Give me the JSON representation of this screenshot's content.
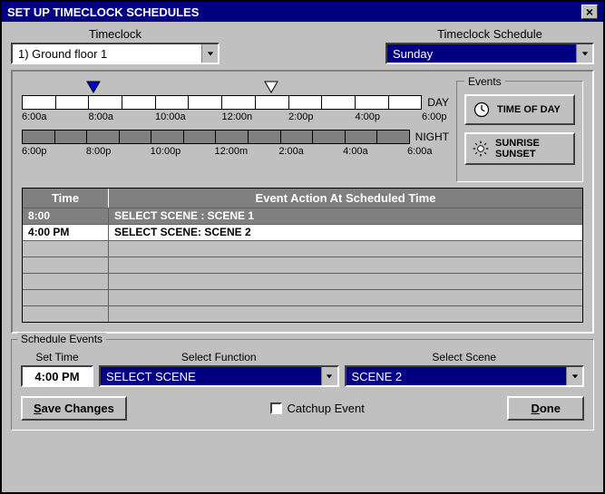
{
  "title": "SET UP TIMECLOCK SCHEDULES",
  "top": {
    "timeclock_label": "Timeclock",
    "timeclock_value": "1) Ground floor 1",
    "schedule_label": "Timeclock Schedule",
    "schedule_value": "Sunday"
  },
  "timeline": {
    "day_label": "DAY",
    "night_label": "NIGHT",
    "day_ticks": [
      "6:00a",
      "8:00a",
      "10:00a",
      "12:00n",
      "2:00p",
      "4:00p",
      "6:00p"
    ],
    "night_ticks": [
      "6:00p",
      "8:00p",
      "10:00p",
      "12:00m",
      "2:00a",
      "4:00a",
      "6:00a"
    ],
    "markers": [
      {
        "pos_pct": 16.7,
        "color": "blue"
      },
      {
        "pos_pct": 58.3,
        "color": "white"
      }
    ]
  },
  "events_box": {
    "legend": "Events",
    "time_of_day": "TIME OF DAY",
    "sunrise_sunset": "SUNRISE SUNSET"
  },
  "table": {
    "col_time": "Time",
    "col_action": "Event Action At Scheduled Time",
    "rows": [
      {
        "time": "8:00",
        "action": "SELECT SCENE : SCENE 1",
        "selected": false
      },
      {
        "time": "4:00 PM",
        "action": "SELECT SCENE: SCENE 2",
        "selected": true
      }
    ],
    "empty_rows": 5
  },
  "schedule_events": {
    "legend": "Schedule Events",
    "set_time_label": "Set Time",
    "set_time_value": "4:00 PM",
    "select_function_label": "Select Function",
    "select_function_value": "SELECT SCENE",
    "select_scene_label": "Select Scene",
    "select_scene_value": "SCENE 2",
    "save_changes": "Save Changes",
    "catchup": "Catchup Event",
    "done": "Done"
  }
}
